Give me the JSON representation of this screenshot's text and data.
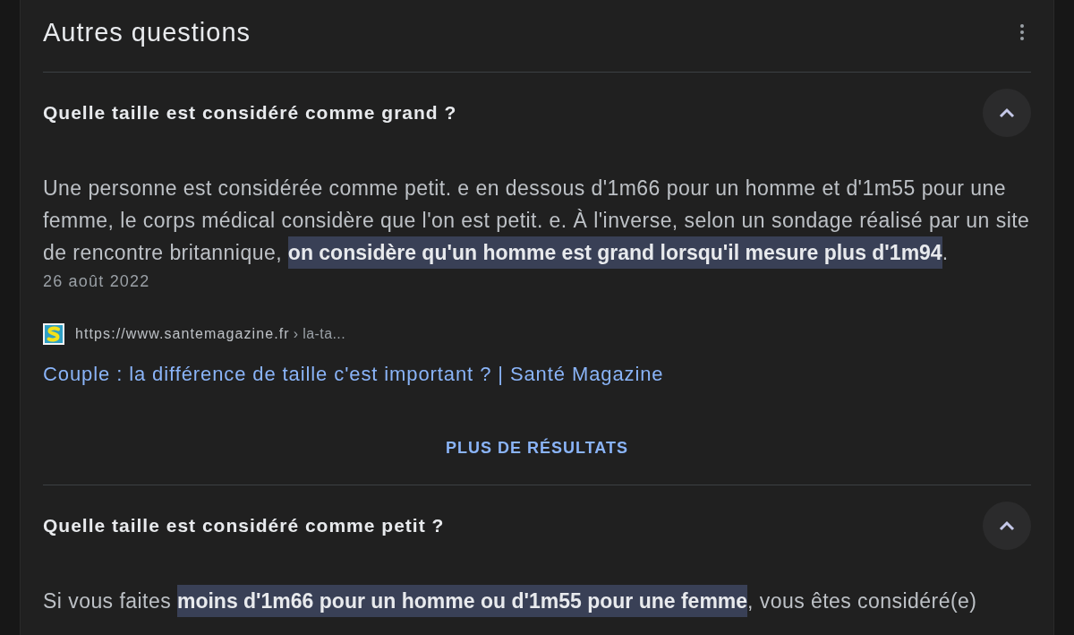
{
  "header": {
    "title": "Autres questions"
  },
  "questions": [
    {
      "question": "Quelle taille est considéré comme grand ?",
      "expanded": true,
      "answer": "Une personne est considérée comme petit. e en dessous d'1m66 pour un homme et d'1m55 pour une femme, le corps médical considère que l'on est petit. e. À l'inverse, selon un sondage réalisé par un site de rencontre britannique, **on considère qu'un homme est grand lorsqu'il mesure plus d'1m94**.",
      "date": "26 août 2022",
      "source": {
        "url": "https://www.santemagazine.fr",
        "path": "› la-ta...",
        "title": "Couple : la différence de taille c'est important ? | Santé Magazine"
      },
      "more_button": "PLUS DE RÉSULTATS"
    },
    {
      "question": "Quelle taille est considéré comme petit ?",
      "expanded": true,
      "answer": "Si vous faites **moins d'1m66 pour un homme ou d'1m55 pour une femme**, vous êtes considéré(e)"
    }
  ]
}
